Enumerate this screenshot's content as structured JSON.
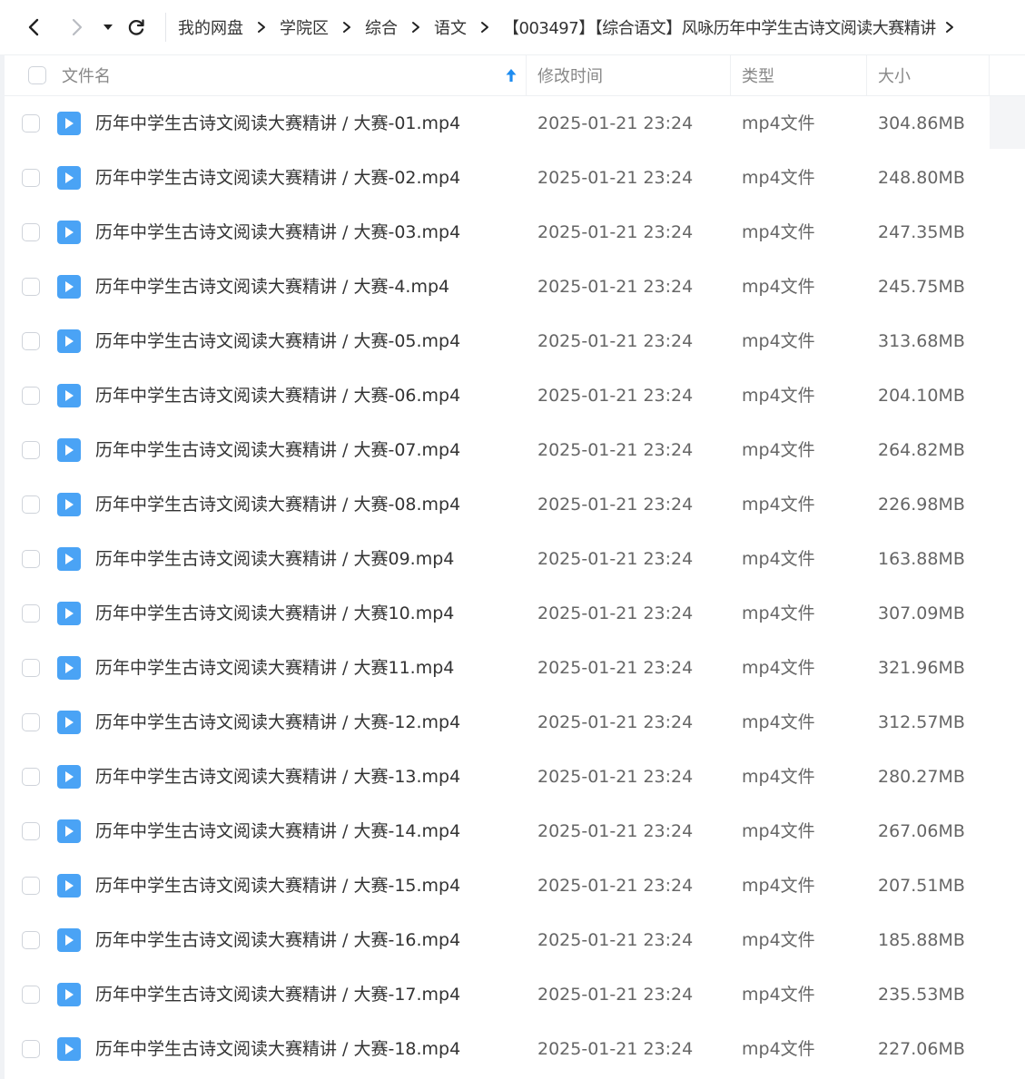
{
  "toolbar": {
    "back_icon": "chevron-left-icon",
    "forward_icon": "chevron-right-icon",
    "dropdown_icon": "caret-down-icon",
    "refresh_icon": "refresh-icon"
  },
  "breadcrumb": [
    "我的网盘",
    "学院区",
    "综合",
    "语文",
    "【003497】【综合语文】风咏历年中学生古诗文阅读大赛精讲"
  ],
  "header": {
    "name": "文件名",
    "modified": "修改时间",
    "type": "类型",
    "size": "大小",
    "sort_icon": "arrow-up-icon"
  },
  "colors": {
    "accent": "#1e8cf0",
    "file_icon": "#4aa3f5"
  },
  "files": [
    {
      "name": "历年中学生古诗文阅读大赛精讲 / 大赛-01.mp4",
      "modified": "2025-01-21 23:24",
      "type": "mp4文件",
      "size": "304.86MB"
    },
    {
      "name": "历年中学生古诗文阅读大赛精讲 / 大赛-02.mp4",
      "modified": "2025-01-21 23:24",
      "type": "mp4文件",
      "size": "248.80MB"
    },
    {
      "name": "历年中学生古诗文阅读大赛精讲 / 大赛-03.mp4",
      "modified": "2025-01-21 23:24",
      "type": "mp4文件",
      "size": "247.35MB"
    },
    {
      "name": "历年中学生古诗文阅读大赛精讲 / 大赛-4.mp4",
      "modified": "2025-01-21 23:24",
      "type": "mp4文件",
      "size": "245.75MB"
    },
    {
      "name": "历年中学生古诗文阅读大赛精讲 / 大赛-05.mp4",
      "modified": "2025-01-21 23:24",
      "type": "mp4文件",
      "size": "313.68MB"
    },
    {
      "name": "历年中学生古诗文阅读大赛精讲 / 大赛-06.mp4",
      "modified": "2025-01-21 23:24",
      "type": "mp4文件",
      "size": "204.10MB"
    },
    {
      "name": "历年中学生古诗文阅读大赛精讲 / 大赛-07.mp4",
      "modified": "2025-01-21 23:24",
      "type": "mp4文件",
      "size": "264.82MB"
    },
    {
      "name": "历年中学生古诗文阅读大赛精讲 / 大赛-08.mp4",
      "modified": "2025-01-21 23:24",
      "type": "mp4文件",
      "size": "226.98MB"
    },
    {
      "name": "历年中学生古诗文阅读大赛精讲 / 大赛09.mp4",
      "modified": "2025-01-21 23:24",
      "type": "mp4文件",
      "size": "163.88MB"
    },
    {
      "name": "历年中学生古诗文阅读大赛精讲 / 大赛10.mp4",
      "modified": "2025-01-21 23:24",
      "type": "mp4文件",
      "size": "307.09MB"
    },
    {
      "name": "历年中学生古诗文阅读大赛精讲 / 大赛11.mp4",
      "modified": "2025-01-21 23:24",
      "type": "mp4文件",
      "size": "321.96MB"
    },
    {
      "name": "历年中学生古诗文阅读大赛精讲 / 大赛-12.mp4",
      "modified": "2025-01-21 23:24",
      "type": "mp4文件",
      "size": "312.57MB"
    },
    {
      "name": "历年中学生古诗文阅读大赛精讲 / 大赛-13.mp4",
      "modified": "2025-01-21 23:24",
      "type": "mp4文件",
      "size": "280.27MB"
    },
    {
      "name": "历年中学生古诗文阅读大赛精讲 / 大赛-14.mp4",
      "modified": "2025-01-21 23:24",
      "type": "mp4文件",
      "size": "267.06MB"
    },
    {
      "name": "历年中学生古诗文阅读大赛精讲 / 大赛-15.mp4",
      "modified": "2025-01-21 23:24",
      "type": "mp4文件",
      "size": "207.51MB"
    },
    {
      "name": "历年中学生古诗文阅读大赛精讲 / 大赛-16.mp4",
      "modified": "2025-01-21 23:24",
      "type": "mp4文件",
      "size": "185.88MB"
    },
    {
      "name": "历年中学生古诗文阅读大赛精讲 / 大赛-17.mp4",
      "modified": "2025-01-21 23:24",
      "type": "mp4文件",
      "size": "235.53MB"
    },
    {
      "name": "历年中学生古诗文阅读大赛精讲 / 大赛-18.mp4",
      "modified": "2025-01-21 23:24",
      "type": "mp4文件",
      "size": "227.06MB"
    }
  ]
}
